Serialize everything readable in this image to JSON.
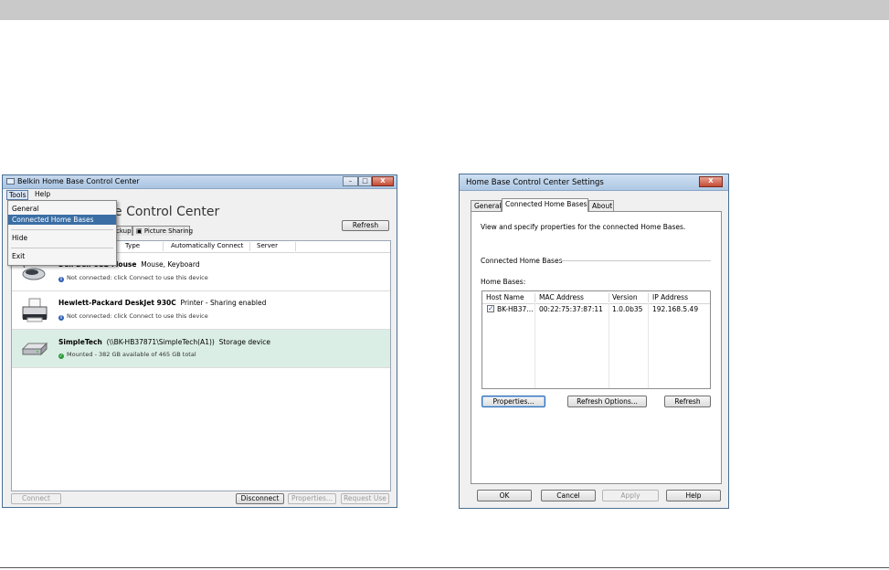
{
  "main_window": {
    "title": "Belkin Home Base Control Center",
    "controls": {
      "minimize": "–",
      "maximize": "□",
      "close": "X"
    },
    "menu": [
      "Tools",
      "Help"
    ],
    "tools_menu": [
      "General",
      "Connected Home Bases",
      "Hide",
      "Exit"
    ],
    "selected_menu_item": "Connected Home Bases",
    "heading_partial": "e Control Center",
    "tabs": [
      "ckup",
      "Picture Sharing"
    ],
    "refresh_label": "Refresh",
    "columns": [
      "Type",
      "Automatically Connect",
      "Server"
    ],
    "devices": [
      {
        "icon": "mouse-icon",
        "name": "Dell Dell USB Mouse",
        "type": "Mouse, Keyboard",
        "status_icon": "info",
        "status": "Not connected: click Connect to use this device"
      },
      {
        "icon": "printer-icon",
        "name": "Hewlett-Packard DeskJet 930C",
        "type": "Printer - Sharing enabled",
        "status_icon": "info",
        "status": "Not connected: click Connect to use this device"
      },
      {
        "icon": "drive-icon",
        "name": "SimpleTech",
        "path": "(\\\\BK-HB37871\\SimpleTech(A1))",
        "type": "Storage device",
        "status_icon": "ok",
        "status": "Mounted - 382 GB available of 465 GB total"
      }
    ],
    "buttons": {
      "connect": "Connect",
      "disconnect": "Disconnect",
      "properties": "Properties...",
      "request_use": "Request Use"
    }
  },
  "settings_window": {
    "title": "Home Base Control Center Settings",
    "close": "X",
    "tabs": [
      "General",
      "Connected Home Bases",
      "About"
    ],
    "active_tab": "Connected Home Bases",
    "description": "View and specify properties for the connected Home Bases.",
    "group_label": "Connected Home Bases",
    "list_label": "Home Bases:",
    "columns": [
      "Host Name",
      "MAC Address",
      "Version",
      "IP Address"
    ],
    "rows": [
      {
        "checked": true,
        "host": "BK-HB37...",
        "mac": "00:22:75:37:87:11",
        "version": "1.0.0b35",
        "ip": "192.168.5.49"
      }
    ],
    "buttons": {
      "properties": "Properties...",
      "refresh_options": "Refresh Options...",
      "refresh": "Refresh",
      "ok": "OK",
      "cancel": "Cancel",
      "apply": "Apply",
      "help": "Help"
    }
  }
}
